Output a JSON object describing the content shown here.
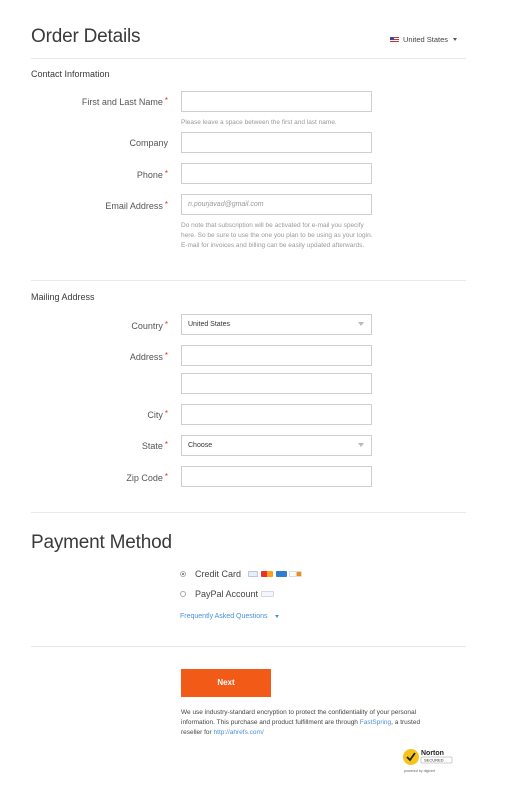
{
  "header": {
    "title": "Order Details",
    "country_selector": "United States"
  },
  "contact": {
    "section_title": "Contact Information",
    "fields": {
      "name": {
        "label": "First and Last Name",
        "value": "",
        "help": "Please leave a space between the first and last name."
      },
      "company": {
        "label": "Company",
        "value": ""
      },
      "phone": {
        "label": "Phone",
        "value": ""
      },
      "email": {
        "label": "Email Address",
        "placeholder": "n.pourjavad@gmail.com",
        "help": "Do note that subscription will be activated for e-mail you specify here. So be sure to use the one you plan to be using as your login. E-mail for invoices and billing can be easily updated afterwards."
      }
    }
  },
  "mailing": {
    "section_title": "Mailing Address",
    "fields": {
      "country": {
        "label": "Country",
        "value": "United States"
      },
      "address": {
        "label": "Address",
        "value": "",
        "value2": ""
      },
      "city": {
        "label": "City",
        "value": ""
      },
      "state": {
        "label": "State",
        "value": "Choose"
      },
      "zip": {
        "label": "Zip Code",
        "value": ""
      }
    }
  },
  "payment": {
    "title": "Payment Method",
    "options": [
      {
        "label": "Credit Card",
        "selected": true
      },
      {
        "label": "PayPal Account",
        "selected": false
      }
    ],
    "faq_link": "Frequently Asked Questions"
  },
  "footer": {
    "next_label": "Next",
    "secure_text_1": "We use industry-standard encryption to protect the confidentiality of your personal information. This purchase and product fulfillment are through",
    "fastspring_link": "FastSpring",
    "secure_text_2": ", a trusted reseller for",
    "ahrefs_link": "http://ahrefs.com/",
    "norton_text": "Norton",
    "norton_sub": "SECURED",
    "norton_powered": "powered by digicert"
  },
  "colors": {
    "accent": "#f25a18",
    "required": "#e8331c",
    "link": "#4a90d9"
  }
}
